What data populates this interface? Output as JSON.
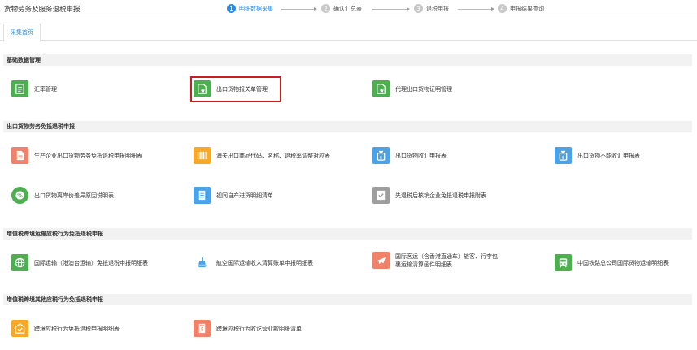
{
  "header": {
    "title": "货物劳务及服务退税申报",
    "steps": [
      {
        "num": "1",
        "label": "明细数据采集",
        "active": true
      },
      {
        "num": "2",
        "label": "确认汇总表",
        "active": false
      },
      {
        "num": "3",
        "label": "退税申报",
        "active": false
      },
      {
        "num": "4",
        "label": "申报结果查询",
        "active": false
      }
    ]
  },
  "tabs": [
    {
      "label": "采集首页"
    }
  ],
  "sections": [
    {
      "title": "基础数据管理",
      "items": [
        {
          "label": "汇率管理",
          "icon": "document-icon",
          "color": "#4caf50"
        },
        {
          "label": "出口货物报关单管理",
          "icon": "document-star-icon",
          "color": "#4caf50",
          "highlighted": true
        },
        {
          "label": "代理出口货物证明管理",
          "icon": "document-star-icon",
          "color": "#4caf50"
        }
      ]
    },
    {
      "title": "出口货物劳务免抵退税申报",
      "items": [
        {
          "label": "生产企业出口货物劳务免抵退税申报明细表",
          "icon": "document-icon",
          "color": "#f0826a"
        },
        {
          "label": "海关出口商品代码、名称、退税率调整对应表",
          "icon": "barcode-icon",
          "color": "#f7a825"
        },
        {
          "label": "出口货物收汇申报表",
          "icon": "money-bag-icon",
          "color": "#4aa3e8"
        },
        {
          "label": "出口货物不能收汇申报表",
          "icon": "money-bag-icon",
          "color": "#4aa3e8"
        },
        {
          "label": "出口货物离岸价差异原因说明表",
          "icon": "percent-icon",
          "color": "#4caf50"
        },
        {
          "label": "视同自产进货明细清单",
          "icon": "list-doc-icon",
          "color": "#4aa3e8"
        },
        {
          "label": "先退税后核销企业免抵退税申报附表",
          "icon": "checklist-icon",
          "color": "#9e9e9e"
        }
      ]
    },
    {
      "title": "增值税跨境运输应税行为免抵退税申报",
      "items": [
        {
          "label": "国际运输（港澳台运输）免抵退税申报明细表",
          "icon": "globe-icon",
          "color": "#4caf50"
        },
        {
          "label": "航空国际运输收入清算账单申报明细表",
          "icon": "ship-icon",
          "color": "#4aa3e8"
        },
        {
          "label": "国际客运（含香港直通车）旅客、行李包裹运输清算函件明细表",
          "icon": "airplane-icon",
          "color": "#f0826a"
        },
        {
          "label": "中国铁路总公司国际货物运输明细表",
          "icon": "train-icon",
          "color": "#4caf50"
        }
      ]
    },
    {
      "title": "增值税跨境其他应税行为免抵退税申报",
      "items": [
        {
          "label": "跨境应税行为免抵退税申报明细表",
          "icon": "document-check-icon",
          "color": "#f7a825"
        },
        {
          "label": "跨境应税行为收讫营业款明细清单",
          "icon": "receipt-icon",
          "color": "#f0826a"
        }
      ]
    }
  ]
}
